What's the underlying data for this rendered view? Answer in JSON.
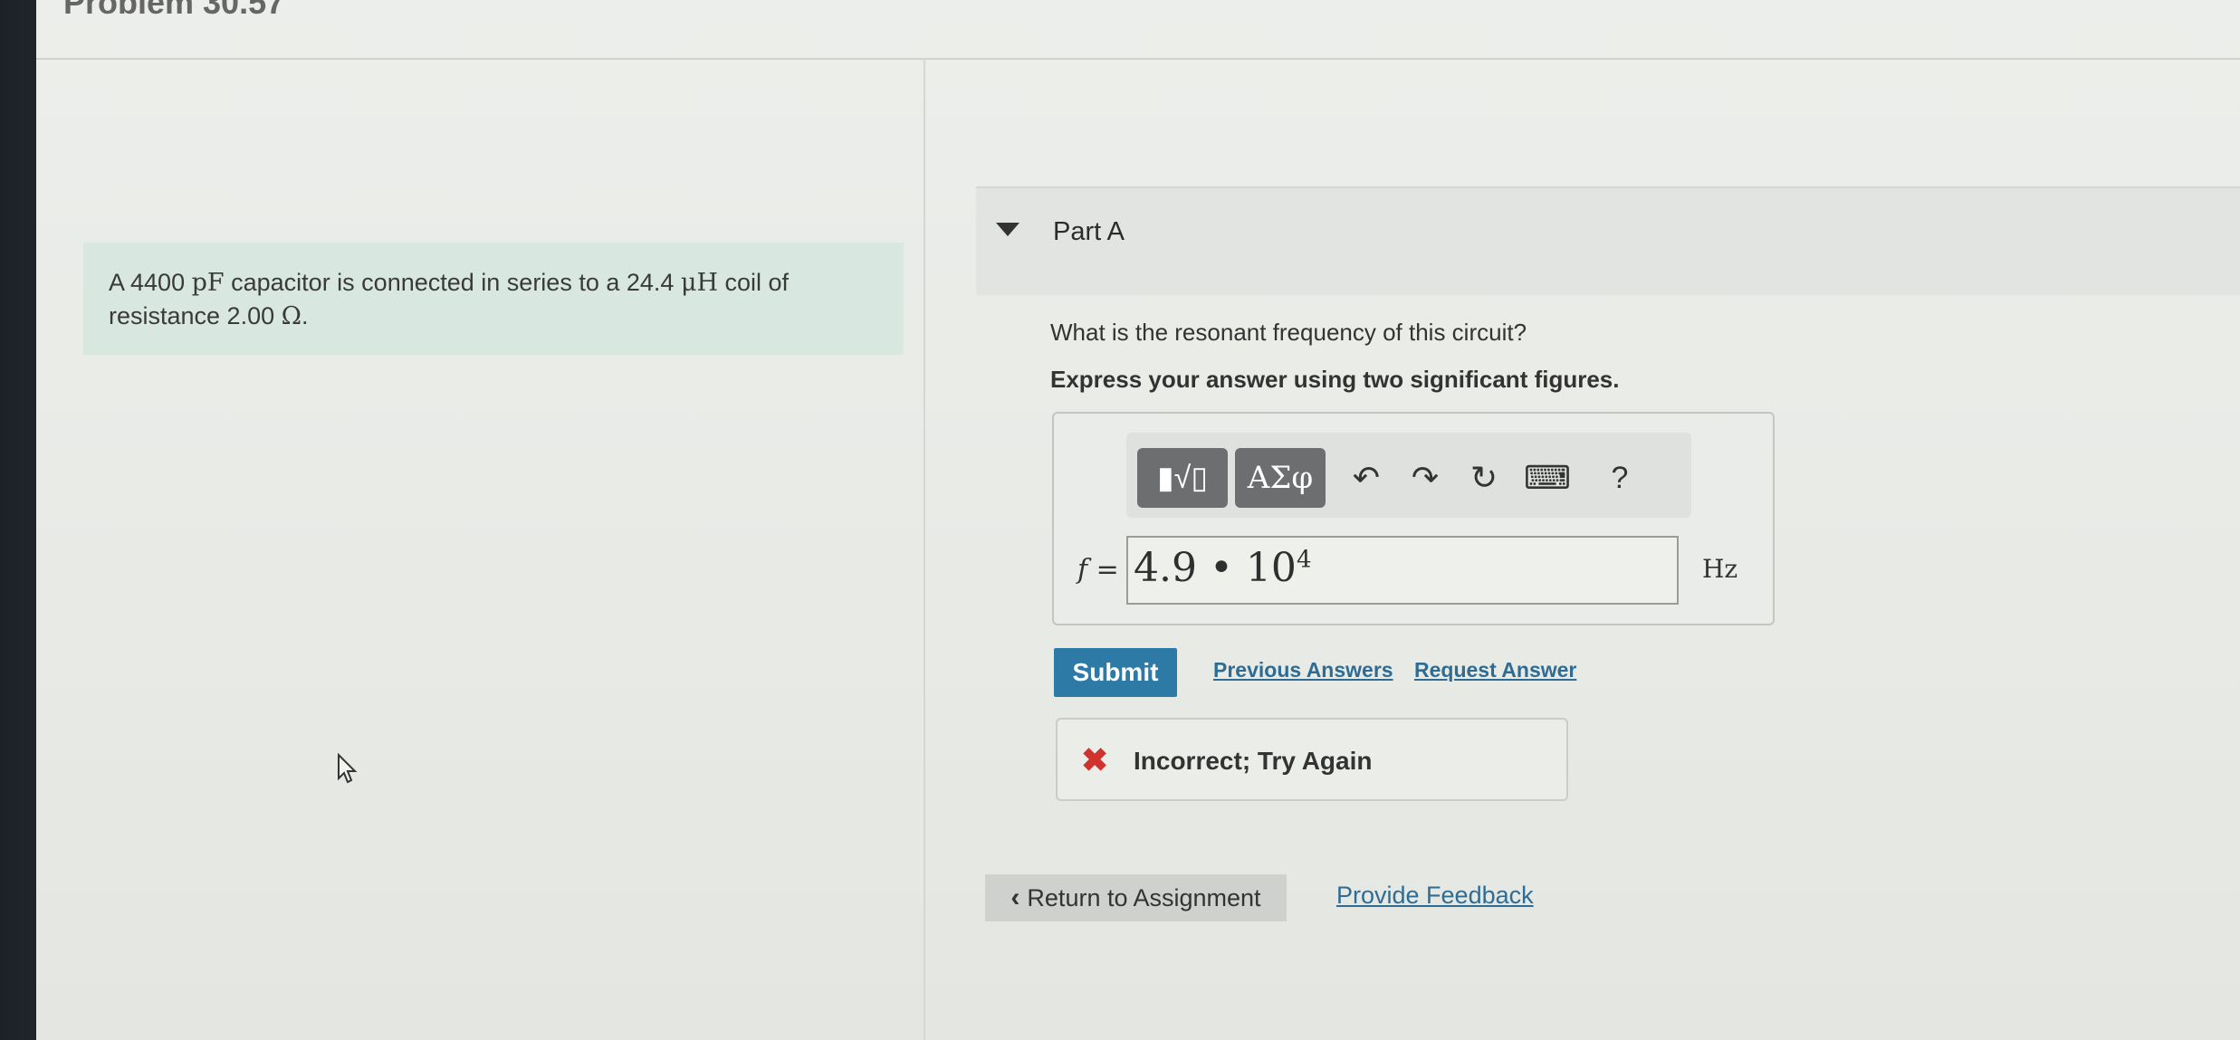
{
  "page": {
    "title": "Problem 30.57"
  },
  "problem": {
    "text_before_pf": "A 4400 ",
    "pf_unit": "pF",
    "text_middle": " capacitor is connected in series to a 24.4 ",
    "uh_unit": "μH",
    "text_after": " coil of resistance 2.00 ",
    "ohm_unit": "Ω",
    "period": "."
  },
  "part": {
    "title": "Part A"
  },
  "question": "What is the resonant frequency of this circuit?",
  "instruction": "Express your answer using two significant figures.",
  "toolbar": {
    "templates_label": "▮√▯",
    "greek_label": "ΑΣφ",
    "undo_icon": "↶",
    "redo_icon": "↷",
    "reset_icon": "↻",
    "keyboard_icon": "⌨",
    "help_label": "?"
  },
  "answer": {
    "variable": "f =",
    "mantissa": "4.9",
    "operator": "•",
    "base": "10",
    "exponent": "4",
    "unit": "Hz"
  },
  "actions": {
    "submit_label": "Submit",
    "previous_answers_label": "Previous Answers",
    "request_answer_label": "Request Answer"
  },
  "feedback": {
    "icon": "✖",
    "message": "Incorrect; Try Again"
  },
  "footer": {
    "return_label": "Return to Assignment",
    "feedback_label": "Provide Feedback"
  },
  "colors": {
    "primary": "#2e7aa6",
    "error": "#d0332e",
    "problem_bg": "#d8e7e0",
    "link": "#2f6c94"
  }
}
